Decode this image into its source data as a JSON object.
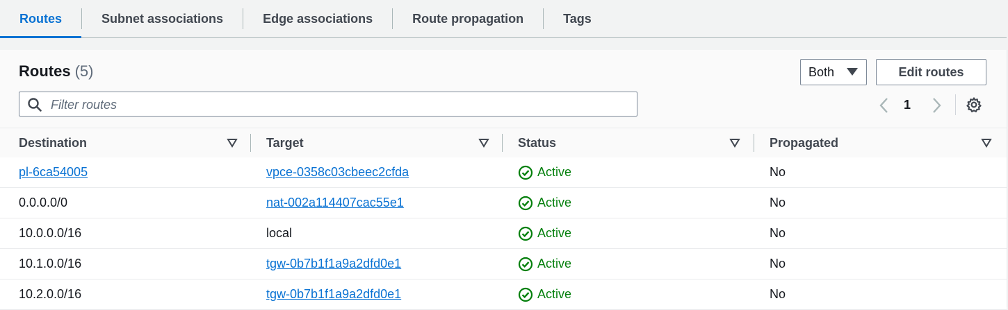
{
  "tabs": [
    {
      "label": "Routes",
      "active": true
    },
    {
      "label": "Subnet associations",
      "active": false
    },
    {
      "label": "Edge associations",
      "active": false
    },
    {
      "label": "Route propagation",
      "active": false
    },
    {
      "label": "Tags",
      "active": false
    }
  ],
  "header": {
    "title": "Routes",
    "count": "(5)"
  },
  "filter_select": {
    "value": "Both"
  },
  "edit_button": {
    "label": "Edit routes"
  },
  "search": {
    "placeholder": "Filter routes",
    "value": ""
  },
  "pagination": {
    "current_page": "1"
  },
  "table": {
    "columns": [
      "Destination",
      "Target",
      "Status",
      "Propagated"
    ],
    "rows": [
      {
        "destination": "pl-6ca54005",
        "destination_link": true,
        "target": "vpce-0358c03cbeec2cfda",
        "target_link": true,
        "status": "Active",
        "propagated": "No"
      },
      {
        "destination": "0.0.0.0/0",
        "destination_link": false,
        "target": "nat-002a114407cac55e1",
        "target_link": true,
        "status": "Active",
        "propagated": "No"
      },
      {
        "destination": "10.0.0.0/16",
        "destination_link": false,
        "target": "local",
        "target_link": false,
        "status": "Active",
        "propagated": "No"
      },
      {
        "destination": "10.1.0.0/16",
        "destination_link": false,
        "target": "tgw-0b7b1f1a9a2dfd0e1",
        "target_link": true,
        "status": "Active",
        "propagated": "No"
      },
      {
        "destination": "10.2.0.0/16",
        "destination_link": false,
        "target": "tgw-0b7b1f1a9a2dfd0e1",
        "target_link": true,
        "status": "Active",
        "propagated": "No"
      }
    ]
  },
  "colors": {
    "accent": "#0972d3",
    "success": "#037f0c",
    "text": "#16191f",
    "muted": "#5f6b7a"
  },
  "icons": {
    "search": "search-icon",
    "settings": "gear-icon",
    "status": "check-circle-icon",
    "sort": "sort-triangle-icon"
  }
}
